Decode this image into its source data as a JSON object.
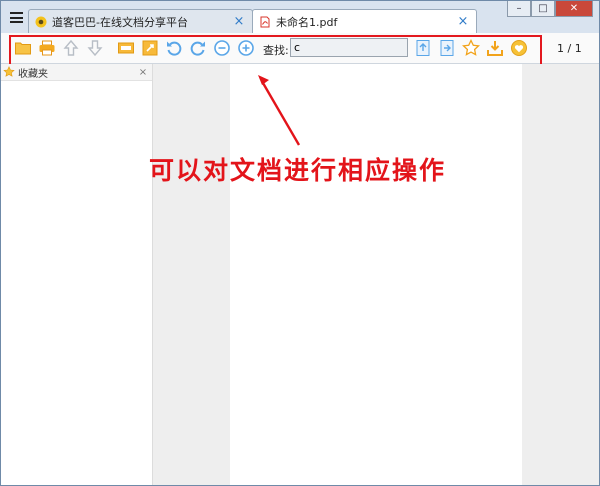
{
  "tabs": [
    {
      "label": "道客巴巴-在线文档分享平台",
      "icon": "docin-logo-icon",
      "close": "×",
      "active": false
    },
    {
      "label": "未命名1.pdf",
      "icon": "pdf-file-icon",
      "close": "×",
      "active": true
    }
  ],
  "window_controls": {
    "minimize": "–",
    "maximize": "□",
    "close": "✕"
  },
  "toolbar": {
    "icons": [
      "open-folder-icon",
      "print-icon",
      "prev-page-icon",
      "next-page-icon",
      "fit-width-icon",
      "fit-page-icon",
      "rotate-left-icon",
      "rotate-right-icon",
      "zoom-out-icon",
      "zoom-in-icon",
      "find-prev-icon",
      "find-next-icon",
      "favorite-star-icon",
      "download-icon",
      "heart-icon"
    ],
    "find_label": "查找:",
    "find_value": "c",
    "page_indicator": "1 / 1"
  },
  "favorites": {
    "title": "收藏夹",
    "close": "×"
  },
  "annotation": {
    "text": "可以对文档进行相应操作"
  },
  "colors": {
    "accent": "#2f7bc8",
    "annotation": "#e3141a",
    "icon_orange": "#f2a31b",
    "icon_blue": "#5aa6e8"
  }
}
